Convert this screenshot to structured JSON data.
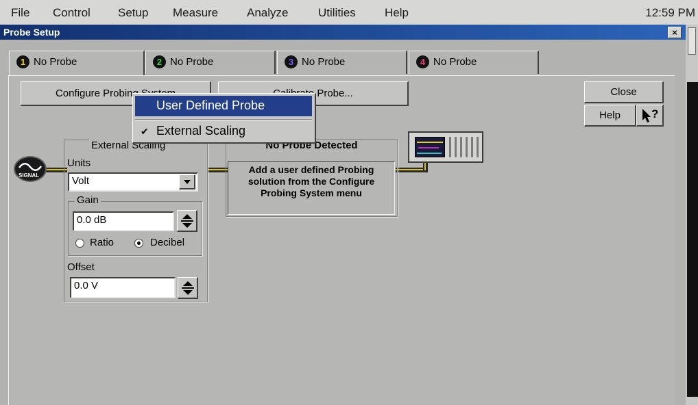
{
  "menubar": {
    "items": [
      "File",
      "Control",
      "Setup",
      "Measure",
      "Analyze",
      "Utilities",
      "Help"
    ],
    "clock": "12:59 PM"
  },
  "dialog": {
    "title": "Probe Setup",
    "close_glyph": "×"
  },
  "tabs": [
    {
      "number": "1",
      "label": "No Probe",
      "color": "#f5e000"
    },
    {
      "number": "2",
      "label": "No Probe",
      "color": "#3cd040"
    },
    {
      "number": "3",
      "label": "No Probe",
      "color": "#7a5cf0"
    },
    {
      "number": "4",
      "label": "No Probe",
      "color": "#f03880"
    }
  ],
  "buttons": {
    "configure": "Configure Probing System",
    "calibrate": "Calibrate Probe...",
    "close": "Close",
    "help": "Help",
    "whats_this_glyph": "?"
  },
  "popup_menu": {
    "items": [
      {
        "label": "User Defined Probe",
        "checked": false,
        "highlighted": true
      },
      {
        "label": "External Scaling",
        "checked": true,
        "highlighted": false
      }
    ],
    "check_glyph": "✔"
  },
  "signal_icon": {
    "label": "SIGNAL"
  },
  "external_scaling": {
    "title": "External Scaling",
    "units_label": "Units",
    "units_value": "Volt",
    "gain_label": "Gain",
    "gain_value": "0.0 dB",
    "ratio_label": "Ratio",
    "decibel_label": "Decibel",
    "mode_selected": "Decibel",
    "offset_label": "Offset",
    "offset_value": "0.0 V"
  },
  "probe_box": {
    "title": "No Probe Detected",
    "message": "Add a user defined Probing solution from the Configure Probing System menu"
  },
  "colors": {
    "title_bar": "#1d4a9a",
    "highlight": "#243f8a",
    "wire": "#d8c020"
  }
}
